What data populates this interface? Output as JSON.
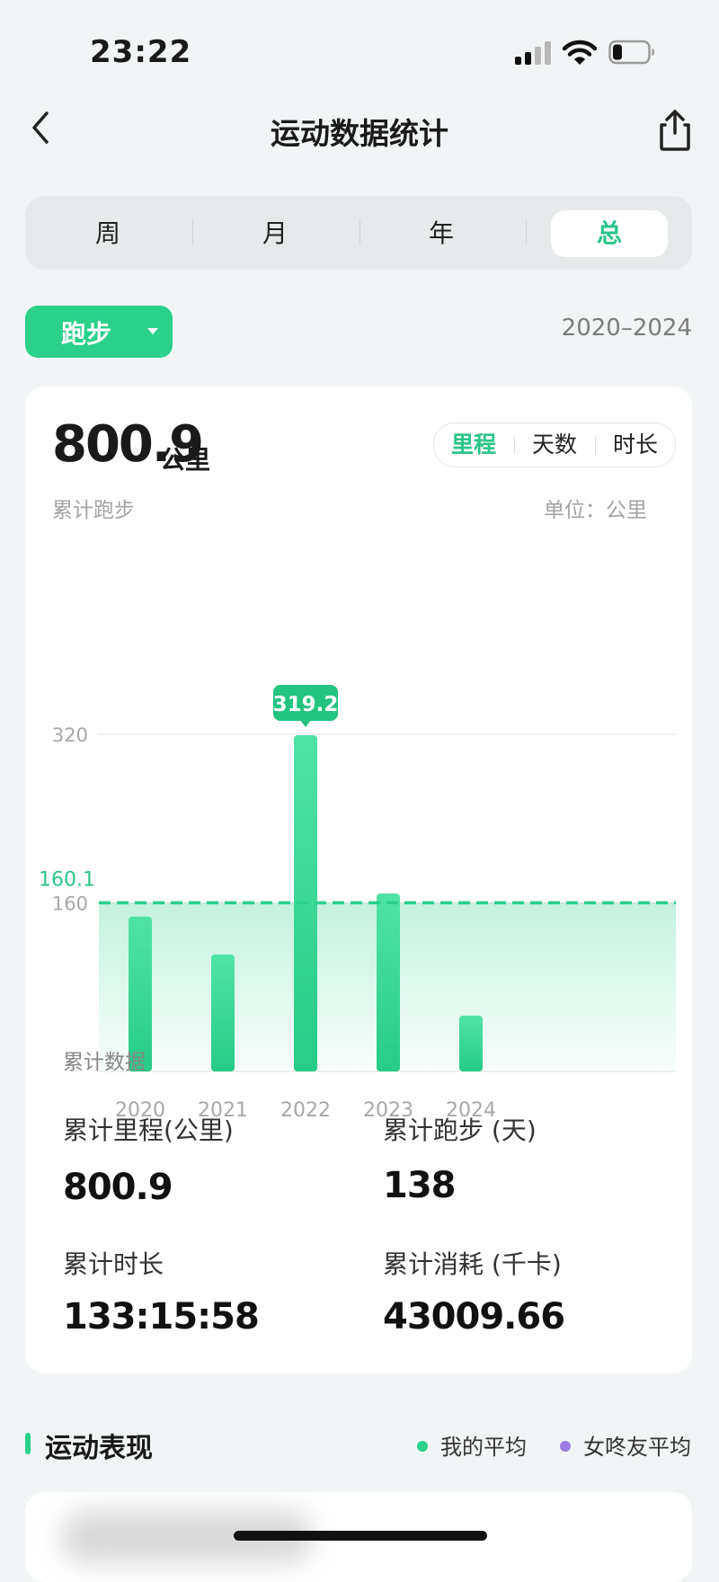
{
  "status_bar": {
    "time": "23:22"
  },
  "nav": {
    "title": "运动数据统计"
  },
  "period_tabs": {
    "items": [
      "周",
      "月",
      "年",
      "总"
    ],
    "active_index": 3
  },
  "sport": {
    "selected": "跑步"
  },
  "date_range": "2020–2024",
  "card": {
    "total_value": "800.9",
    "total_unit": "公里",
    "caption": "累计跑步",
    "unit_caption": "单位：公里",
    "metric_tabs": [
      "里程",
      "天数",
      "时长"
    ],
    "active_metric": 0
  },
  "colors": {
    "accent": "#2bd08b",
    "accent_text": "#2bc587",
    "friends_avg": "#9b7be0"
  },
  "chart_data": {
    "type": "bar",
    "categories": [
      "2020",
      "2021",
      "2022",
      "2023",
      "2024"
    ],
    "values": [
      147,
      111,
      319.2,
      169,
      53
    ],
    "ylim": [
      0,
      320
    ],
    "y_ticks": [
      160,
      320
    ],
    "y_tick_labels": [
      "160",
      "320"
    ],
    "average": 160.1,
    "average_label": "160.1",
    "highlight_label": "319.2",
    "highlight_index": 2,
    "grid": true
  },
  "summary": {
    "title": "累计数据",
    "items": [
      {
        "label": "累计里程(公里)",
        "value": "800.9"
      },
      {
        "label": "累计跑步 (天)",
        "value": "138"
      },
      {
        "label": "累计时长",
        "value": "133:15:58"
      },
      {
        "label": "累计消耗 (千卡)",
        "value": "43009.66"
      }
    ]
  },
  "performance": {
    "title": "运动表现",
    "legend": [
      "我的平均",
      "女咚友平均"
    ]
  }
}
